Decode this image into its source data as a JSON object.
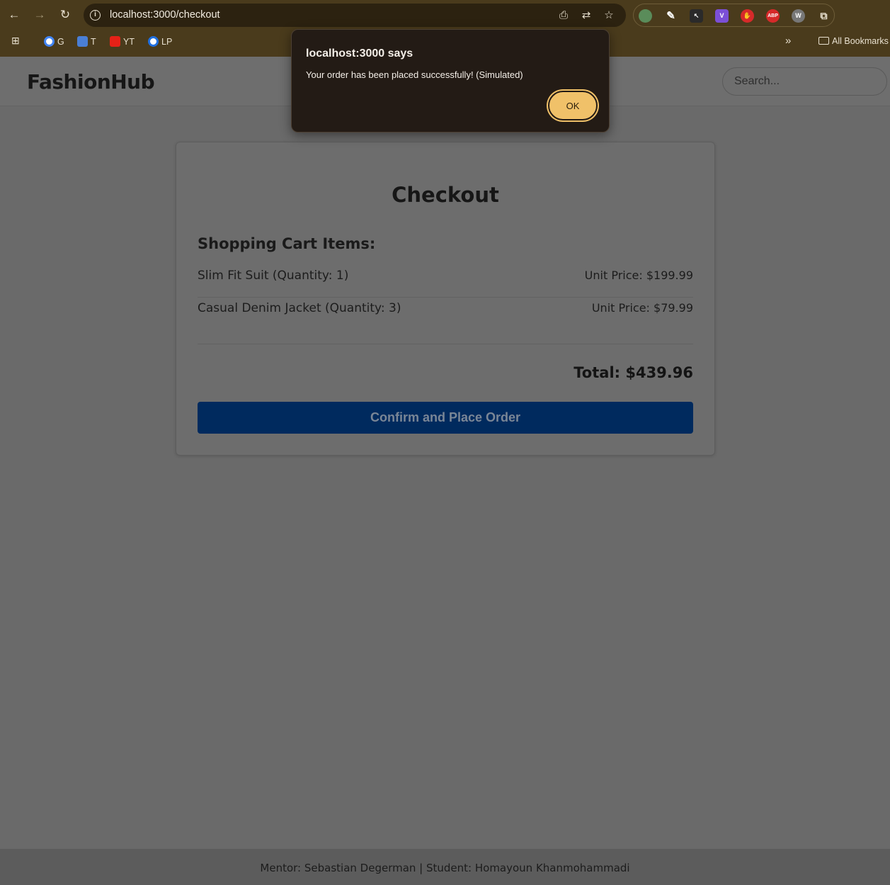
{
  "browser": {
    "url": "localhost:3000/checkout",
    "bookmarks": [
      {
        "label": "G"
      },
      {
        "label": "T"
      },
      {
        "label": "YT"
      },
      {
        "label": "LP"
      }
    ],
    "all_bookmarks_label": "All Bookmarks",
    "overflow_label": "»"
  },
  "header": {
    "logo": "FashionHub",
    "search_placeholder": "Search..."
  },
  "checkout": {
    "title": "Checkout",
    "cart_heading": "Shopping Cart Items:",
    "items": [
      {
        "name": "Slim Fit Suit (Quantity: 1)",
        "price": "Unit Price: $199.99"
      },
      {
        "name": "Casual Denim Jacket (Quantity: 3)",
        "price": "Unit Price: $79.99"
      }
    ],
    "total": "Total: $439.96",
    "confirm_label": "Confirm and Place Order"
  },
  "footer": {
    "text": "Mentor: Sebastian Degerman | Student: Homayoun Khanmohammadi"
  },
  "dialog": {
    "title": "localhost:3000 says",
    "message": "Your order has been placed successfully! (Simulated)",
    "ok_label": "OK"
  },
  "colors": {
    "chrome": "#4a3b1c",
    "dialog_bg": "#231b15",
    "ok_button": "#f0c169",
    "confirm_button": "#002a5e"
  }
}
